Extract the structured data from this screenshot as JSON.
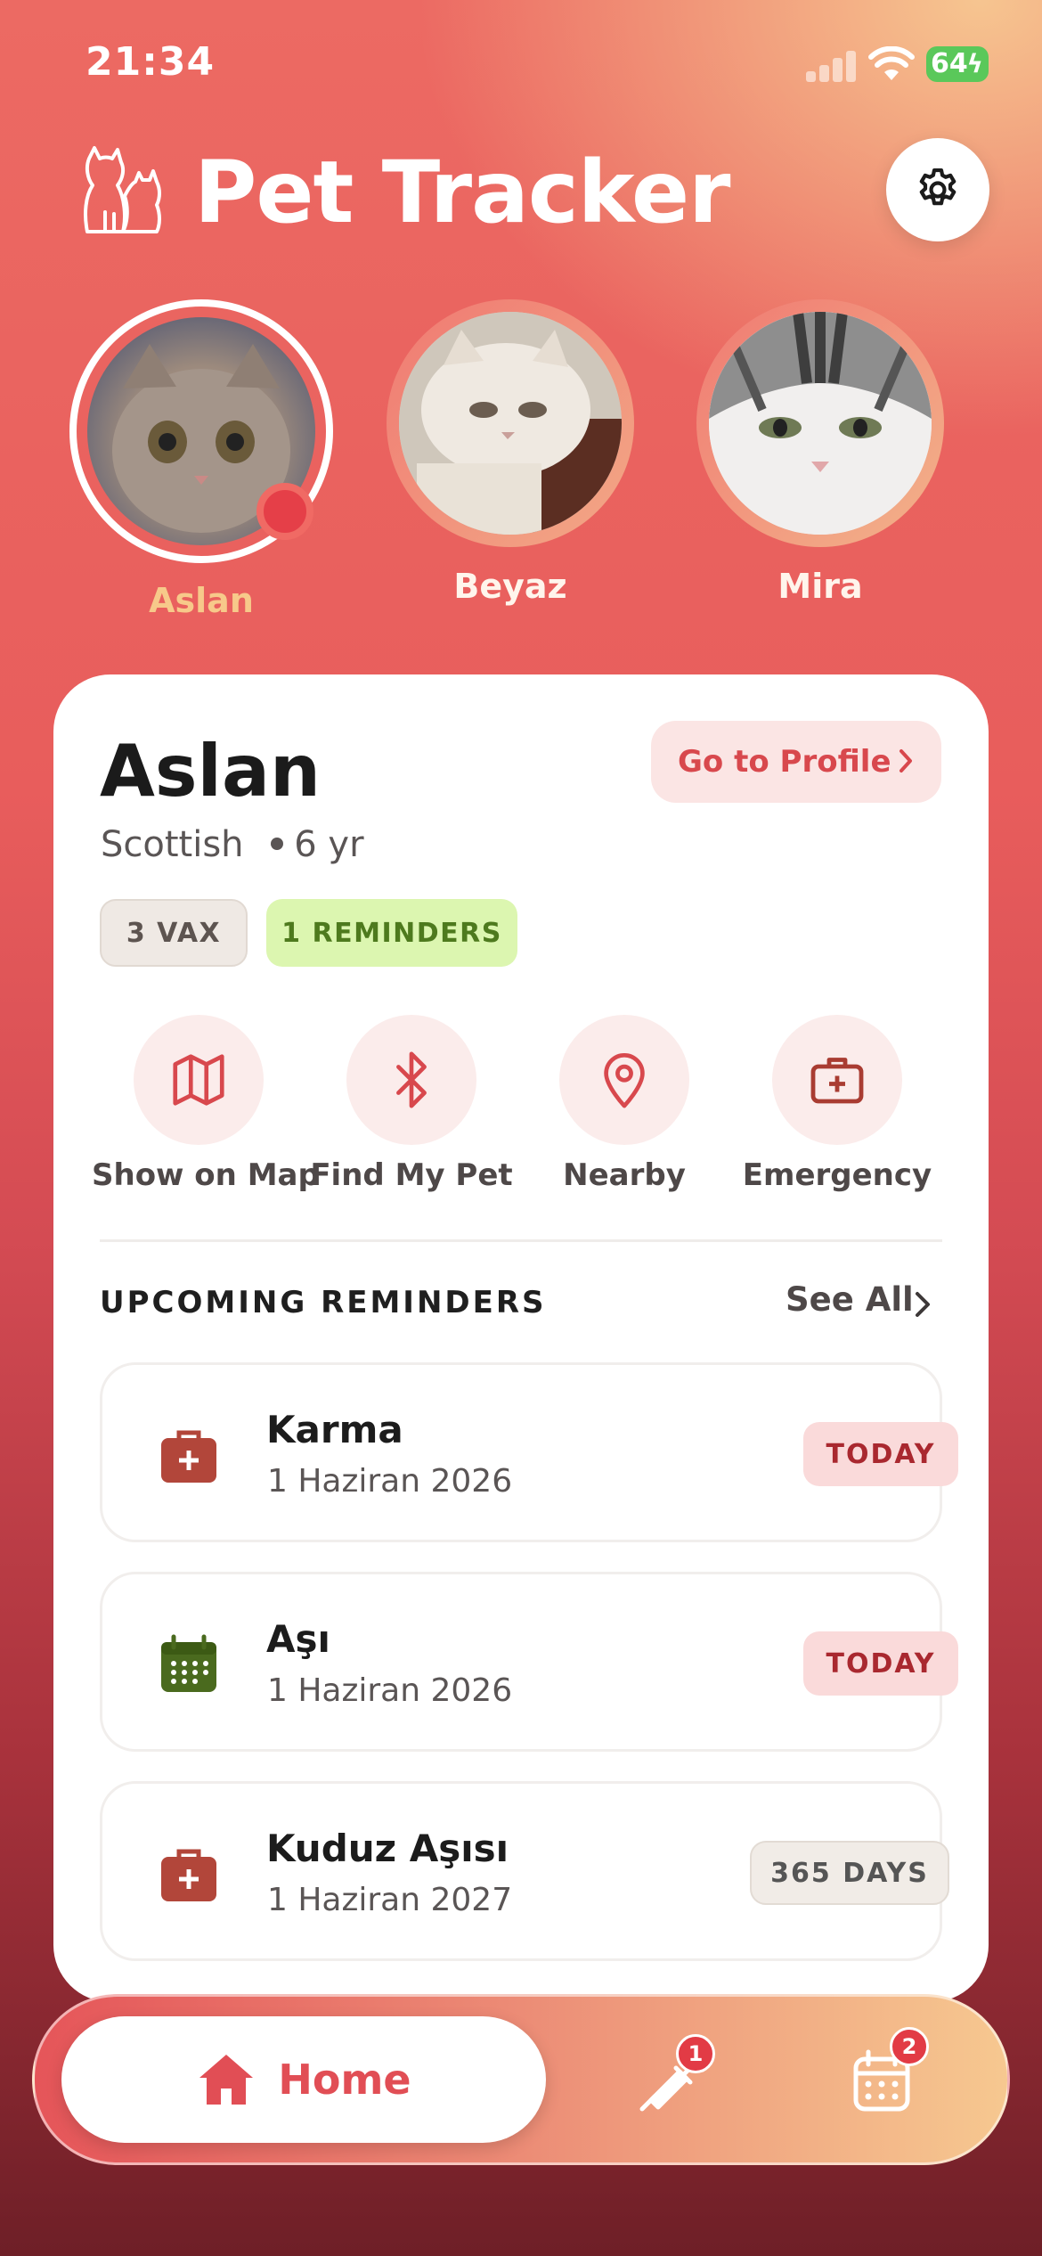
{
  "status_bar": {
    "time": "21:34",
    "battery": "64"
  },
  "header": {
    "title": "Pet Tracker"
  },
  "pets": [
    {
      "name": "Aslan",
      "selected": true
    },
    {
      "name": "Beyaz",
      "selected": false
    },
    {
      "name": "Mira",
      "selected": false
    }
  ],
  "card": {
    "pet_name": "Aslan",
    "breed": "Scottish",
    "age": "6 yr",
    "profile_button": "Go to Profile",
    "badges": {
      "vax": "3 VAX",
      "reminders": "1 REMINDERS"
    },
    "actions": [
      {
        "label": "Show on Map",
        "icon": "map-icon"
      },
      {
        "label": "Find My Pet",
        "icon": "bluetooth-icon"
      },
      {
        "label": "Nearby",
        "icon": "location-pin-icon"
      },
      {
        "label": "Emergency",
        "icon": "first-aid-kit-icon"
      }
    ],
    "section_title": "UPCOMING REMINDERS",
    "see_all": "See All",
    "reminders": [
      {
        "title": "Karma",
        "date": "1 Haziran 2026",
        "status": "TODAY",
        "icon": "medical-bag-icon"
      },
      {
        "title": "Aşı",
        "date": "1 Haziran 2026",
        "status": "TODAY",
        "icon": "calendar-icon"
      },
      {
        "title": "Kuduz Aşısı",
        "date": "1 Haziran 2027",
        "status": "365 DAYS",
        "icon": "medical-bag-icon"
      }
    ]
  },
  "tab_bar": {
    "home_label": "Home",
    "vaccine_badge": "1",
    "calendar_badge": "2"
  },
  "colors": {
    "accent": "#e14e55",
    "selected_pet_name": "#f7c98a",
    "reminder_badge_bg": "#dcf6b0",
    "today_badge_bg": "#fadada"
  }
}
